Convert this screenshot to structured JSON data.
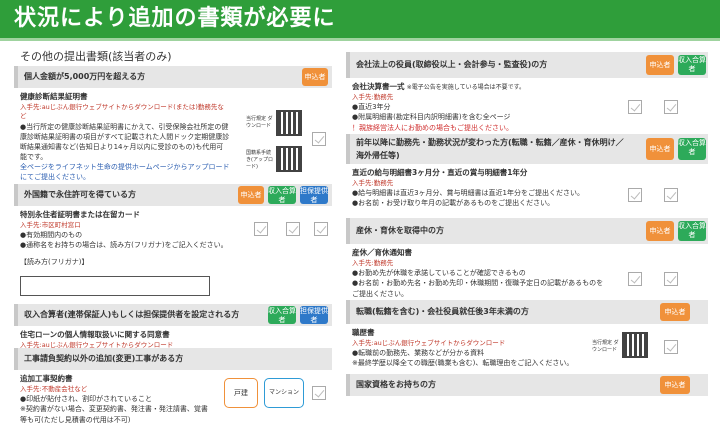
{
  "title": "状況により追加の書類が必要に",
  "left": {
    "heading": "その他の提出書類(該当者のみ)",
    "sections": [
      {
        "header": "個人金額が5,000万円を超える方",
        "badges": [
          "申込者"
        ],
        "item": "健康診断結果証明書",
        "who": "入手先:auじぶん銀行ウェブサイトからダウンロード(または)勤務先など",
        "lines": [
          "●当行所定の健康診断結果証明書にかえて、引受保険会社所定の健康診断結果証明書の項目がすべて記載された人間ドック定期健康診断結果通知書など(告知日より14ヶ月以内に受診のもの)も代用可能です。"
        ],
        "red": "全ページをライフネット生命の提供ホームページからアップロードにてご提出ください。",
        "qr1": "当行規定 ダウンロード",
        "qr2": "国籍系手続き(アップロード)"
      },
      {
        "header": "外国籍で永住許可を得ている方",
        "badges": [
          "申込者",
          "収入合算者",
          "担保提供者"
        ],
        "item": "特別永住者証明書または在留カード",
        "who": "入手先:市区町村窓口",
        "lines": [
          "●有効期間内のもの",
          "●通称名をお持ちの場合は、読み方(フリガナ)をご記入ください。"
        ],
        "field_label": "【読み方(フリガナ)】"
      },
      {
        "header": "収入合算者(連帯保証人)もしくは担保提供者を設定される方",
        "badges": [
          "収入合算者",
          "担保提供者"
        ],
        "item": "住宅ローンの個人情報取扱いに関する同意書",
        "who": "入手先:auじぶん銀行ウェブサイトからダウンロード"
      },
      {
        "header": "工事請負契約以外の追加(変更)工事がある方",
        "item": "追加工事契約書",
        "who": "入手先:不動産会社など",
        "lines": [
          "●印紙が貼付され、割印がされていること",
          "※契約書がない場合、変更契約書、発注書・発注請書、覚書等も可(ただし見積書の代用は不可)"
        ],
        "pill1": "戸建",
        "pill2": "マンション"
      }
    ]
  },
  "right": {
    "sections": [
      {
        "header": "会社法上の役員(取締役以上・会計参与・監査役)の方",
        "badges": [
          "申込者",
          "収入合算者"
        ],
        "item": "会社決算書一式",
        "item_note": "※電子公告を実施している場合は不要です。",
        "who": "入手先:勤務先",
        "lines": [
          "●直近3年分",
          "●附属明細書(勘定科目内訳明細書)を含む全ページ"
        ],
        "red": "！親族経営法人にお勤めの場合もご提出ください。"
      },
      {
        "header": "前年以降に勤務先・勤務状況が変わった方(転職・転籍／産休・育休明け／海外帰任等)",
        "badges": [
          "申込者",
          "収入合算者"
        ],
        "item": "直近の給与明細書3ヶ月分・直近の賞与明細書1年分",
        "who": "入手先:勤務先",
        "lines": [
          "●給与明細書は直近3ヶ月分、賞与明細書は直近1年分をご提出ください。",
          "●お名前・お受け取り年月の記載があるものをご提出ください。"
        ]
      },
      {
        "header": "産休・育休を取得中の方",
        "badges": [
          "申込者",
          "収入合算者"
        ],
        "item": "産休／育休通知書",
        "who": "入手先:勤務先",
        "lines": [
          "●お勤め先が休職を承諾していることが確認できるもの",
          "●お名前・お勤め先名・お勤め先印・休職期間・復職予定日の記載があるものをご提出ください。"
        ]
      },
      {
        "header": "転職(転籍を含む)・会社役員就任後3年未満の方",
        "badges": [
          "申込者"
        ],
        "item": "職歴書",
        "who": "入手先:auじぶん銀行ウェブサイトからダウンロード",
        "lines": [
          "●転職前の勤務先、業務などが分かる資料",
          "※最終学歴以降全ての職歴(職業も含む)、転職理由をご記入ください。"
        ],
        "qr1": "当行規定 ダウンロード"
      },
      {
        "header": "国家資格をお持ちの方",
        "badges": [
          "申込者"
        ]
      }
    ]
  },
  "colors": {
    "title_bg": "#2f9e3a",
    "applicant": "#f0913a",
    "co_income": "#2daa5a",
    "guarantor": "#2e79c9"
  }
}
